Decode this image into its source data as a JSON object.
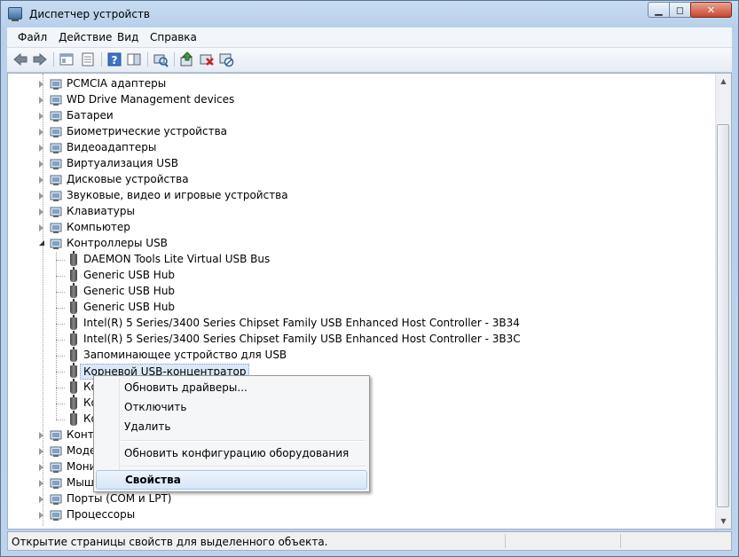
{
  "window": {
    "title": "Диспетчер устройств",
    "min_glyph": "▁",
    "max_glyph": "◻",
    "close_glyph": "✕"
  },
  "menu": {
    "items": [
      "Файл",
      "Действие",
      "Вид",
      "Справка"
    ]
  },
  "toolbar": {
    "buttons": [
      "back-icon",
      "forward-icon",
      "show-hide-tree-icon",
      "properties-icon",
      "help-icon",
      "scan-hardware-icon",
      "update-driver-icon",
      "uninstall-icon",
      "disable-icon"
    ]
  },
  "tree": {
    "categories_top": [
      "PCMCIA адаптеры",
      "WD Drive Management devices",
      "Батареи",
      "Биометрические устройства",
      "Видеоадаптеры",
      "Виртуализация USB",
      "Дисковые устройства",
      "Звуковые, видео и игровые устройства",
      "Клавиатуры",
      "Компьютер"
    ],
    "usb_category": "Контроллеры USB",
    "usb_children": [
      "DAEMON Tools Lite Virtual USB Bus",
      "Generic USB Hub",
      "Generic USB Hub",
      "Generic USB Hub",
      "Intel(R) 5 Series/3400 Series Chipset Family USB Enhanced Host Controller - 3B34",
      "Intel(R) 5 Series/3400 Series Chipset Family USB Enhanced Host Controller - 3B3C",
      "Запоминающее устройство для USB",
      "Корневой USB-концентратор",
      "Ко",
      "Ко",
      "Ко"
    ],
    "categories_bottom": [
      "Контр",
      "Моде",
      "Мони",
      "Мыш",
      "Порты (COM и LPT)",
      "Процессоры"
    ],
    "selected_index": 7
  },
  "context_menu": {
    "update": "Обновить драйверы...",
    "disable": "Отключить",
    "delete": "Удалить",
    "scan": "Обновить конфигурацию оборудования",
    "properties": "Свойства"
  },
  "status": {
    "text": "Открытие страницы свойств для выделенного объекта."
  }
}
